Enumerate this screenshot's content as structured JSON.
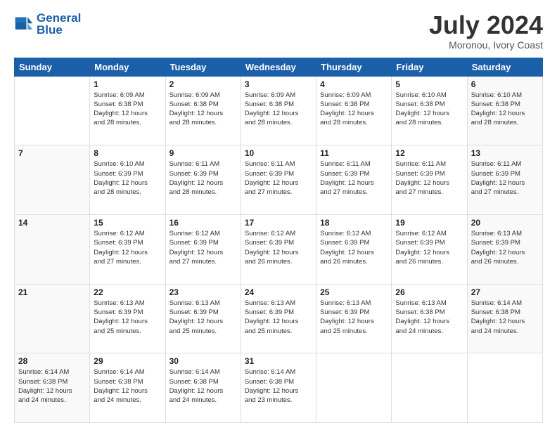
{
  "header": {
    "logo_line1": "General",
    "logo_line2": "Blue",
    "month_year": "July 2024",
    "location": "Moronou, Ivory Coast"
  },
  "weekdays": [
    "Sunday",
    "Monday",
    "Tuesday",
    "Wednesday",
    "Thursday",
    "Friday",
    "Saturday"
  ],
  "weeks": [
    [
      {
        "day": "",
        "info": ""
      },
      {
        "day": "1",
        "info": "Sunrise: 6:09 AM\nSunset: 6:38 PM\nDaylight: 12 hours\nand 28 minutes."
      },
      {
        "day": "2",
        "info": "Sunrise: 6:09 AM\nSunset: 6:38 PM\nDaylight: 12 hours\nand 28 minutes."
      },
      {
        "day": "3",
        "info": "Sunrise: 6:09 AM\nSunset: 6:38 PM\nDaylight: 12 hours\nand 28 minutes."
      },
      {
        "day": "4",
        "info": "Sunrise: 6:09 AM\nSunset: 6:38 PM\nDaylight: 12 hours\nand 28 minutes."
      },
      {
        "day": "5",
        "info": "Sunrise: 6:10 AM\nSunset: 6:38 PM\nDaylight: 12 hours\nand 28 minutes."
      },
      {
        "day": "6",
        "info": "Sunrise: 6:10 AM\nSunset: 6:38 PM\nDaylight: 12 hours\nand 28 minutes."
      }
    ],
    [
      {
        "day": "7",
        "info": ""
      },
      {
        "day": "8",
        "info": "Sunrise: 6:10 AM\nSunset: 6:39 PM\nDaylight: 12 hours\nand 28 minutes."
      },
      {
        "day": "9",
        "info": "Sunrise: 6:11 AM\nSunset: 6:39 PM\nDaylight: 12 hours\nand 28 minutes."
      },
      {
        "day": "10",
        "info": "Sunrise: 6:11 AM\nSunset: 6:39 PM\nDaylight: 12 hours\nand 27 minutes."
      },
      {
        "day": "11",
        "info": "Sunrise: 6:11 AM\nSunset: 6:39 PM\nDaylight: 12 hours\nand 27 minutes."
      },
      {
        "day": "12",
        "info": "Sunrise: 6:11 AM\nSunset: 6:39 PM\nDaylight: 12 hours\nand 27 minutes."
      },
      {
        "day": "13",
        "info": "Sunrise: 6:11 AM\nSunset: 6:39 PM\nDaylight: 12 hours\nand 27 minutes."
      }
    ],
    [
      {
        "day": "14",
        "info": ""
      },
      {
        "day": "15",
        "info": "Sunrise: 6:12 AM\nSunset: 6:39 PM\nDaylight: 12 hours\nand 27 minutes."
      },
      {
        "day": "16",
        "info": "Sunrise: 6:12 AM\nSunset: 6:39 PM\nDaylight: 12 hours\nand 27 minutes."
      },
      {
        "day": "17",
        "info": "Sunrise: 6:12 AM\nSunset: 6:39 PM\nDaylight: 12 hours\nand 26 minutes."
      },
      {
        "day": "18",
        "info": "Sunrise: 6:12 AM\nSunset: 6:39 PM\nDaylight: 12 hours\nand 26 minutes."
      },
      {
        "day": "19",
        "info": "Sunrise: 6:12 AM\nSunset: 6:39 PM\nDaylight: 12 hours\nand 26 minutes."
      },
      {
        "day": "20",
        "info": "Sunrise: 6:13 AM\nSunset: 6:39 PM\nDaylight: 12 hours\nand 26 minutes."
      }
    ],
    [
      {
        "day": "21",
        "info": ""
      },
      {
        "day": "22",
        "info": "Sunrise: 6:13 AM\nSunset: 6:39 PM\nDaylight: 12 hours\nand 25 minutes."
      },
      {
        "day": "23",
        "info": "Sunrise: 6:13 AM\nSunset: 6:39 PM\nDaylight: 12 hours\nand 25 minutes."
      },
      {
        "day": "24",
        "info": "Sunrise: 6:13 AM\nSunset: 6:39 PM\nDaylight: 12 hours\nand 25 minutes."
      },
      {
        "day": "25",
        "info": "Sunrise: 6:13 AM\nSunset: 6:39 PM\nDaylight: 12 hours\nand 25 minutes."
      },
      {
        "day": "26",
        "info": "Sunrise: 6:13 AM\nSunset: 6:38 PM\nDaylight: 12 hours\nand 24 minutes."
      },
      {
        "day": "27",
        "info": "Sunrise: 6:14 AM\nSunset: 6:38 PM\nDaylight: 12 hours\nand 24 minutes."
      }
    ],
    [
      {
        "day": "28",
        "info": "Sunrise: 6:14 AM\nSunset: 6:38 PM\nDaylight: 12 hours\nand 24 minutes."
      },
      {
        "day": "29",
        "info": "Sunrise: 6:14 AM\nSunset: 6:38 PM\nDaylight: 12 hours\nand 24 minutes."
      },
      {
        "day": "30",
        "info": "Sunrise: 6:14 AM\nSunset: 6:38 PM\nDaylight: 12 hours\nand 24 minutes."
      },
      {
        "day": "31",
        "info": "Sunrise: 6:14 AM\nSunset: 6:38 PM\nDaylight: 12 hours\nand 23 minutes."
      },
      {
        "day": "",
        "info": ""
      },
      {
        "day": "",
        "info": ""
      },
      {
        "day": "",
        "info": ""
      }
    ]
  ]
}
